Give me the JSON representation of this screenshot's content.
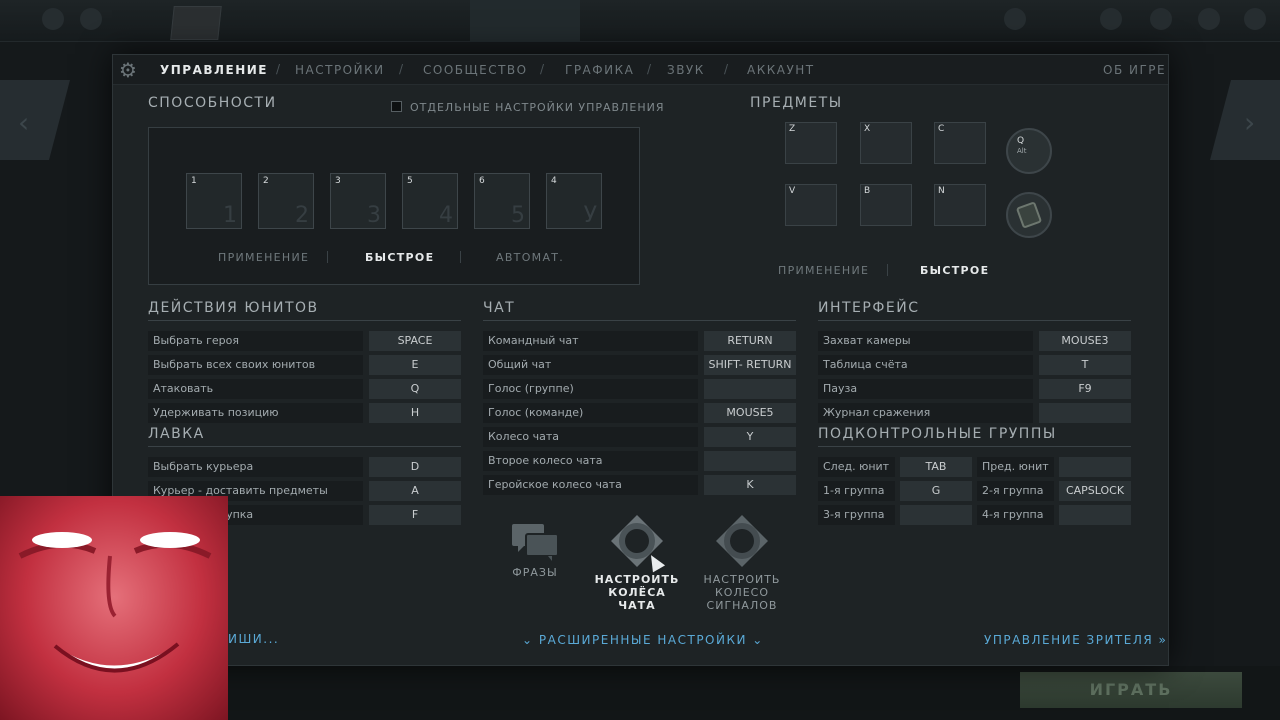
{
  "tabs": [
    {
      "label": "УПРАВЛЕНИЕ",
      "active": true
    },
    {
      "label": "НАСТРОЙКИ",
      "active": false
    },
    {
      "label": "СООБЩЕСТВО",
      "active": false
    },
    {
      "label": "ГРАФИКА",
      "active": false
    },
    {
      "label": "ЗВУК",
      "active": false
    },
    {
      "label": "АККАУНТ",
      "active": false
    }
  ],
  "tab_separator": "/",
  "about_label": "ОБ ИГРЕ",
  "abilities": {
    "title": "СПОСОБНОСТИ",
    "separate_controls_label": "ОТДЕЛЬНЫЕ НАСТРОЙКИ УПРАВЛЕНИЯ",
    "slots": [
      {
        "key": "1",
        "hint": "1"
      },
      {
        "key": "2",
        "hint": "2"
      },
      {
        "key": "3",
        "hint": "3"
      },
      {
        "key": "5",
        "hint": "4"
      },
      {
        "key": "6",
        "hint": "5"
      },
      {
        "key": "4",
        "hint": "У"
      }
    ],
    "modes": [
      {
        "label": "ПРИМЕНЕНИЕ",
        "active": false
      },
      {
        "label": "БЫСТРОЕ",
        "active": true
      },
      {
        "label": "АВТОМАТ.",
        "active": false
      }
    ]
  },
  "items": {
    "title": "ПРЕДМЕТЫ",
    "slots": [
      {
        "key": "Z"
      },
      {
        "key": "X"
      },
      {
        "key": "C"
      },
      {
        "key": "V"
      },
      {
        "key": "B"
      },
      {
        "key": "N"
      }
    ],
    "neutral_slot": {
      "key": "Q",
      "modifier": "Alt"
    },
    "modes": [
      {
        "label": "ПРИМЕНЕНИЕ",
        "active": false
      },
      {
        "label": "БЫСТРОЕ",
        "active": true
      }
    ]
  },
  "unit_actions": {
    "title": "ДЕЙСТВИЯ ЮНИТОВ",
    "rows": [
      {
        "label": "Выбрать героя",
        "key": "SPACE"
      },
      {
        "label": "Выбрать всех своих юнитов",
        "key": "E"
      },
      {
        "label": "Атаковать",
        "key": "Q"
      },
      {
        "label": "Удерживать позицию",
        "key": "H"
      }
    ]
  },
  "shop": {
    "title": "ЛАВКА",
    "rows": [
      {
        "label": "Выбрать курьера",
        "key": "D"
      },
      {
        "label": "Курьер - доставить предметы",
        "key": "A"
      },
      {
        "label": "Быстрая покупка",
        "key": "F"
      }
    ]
  },
  "chat": {
    "title": "ЧАТ",
    "rows": [
      {
        "label": "Командный чат",
        "key": "RETURN"
      },
      {
        "label": "Общий чат",
        "key": "SHIFT- RETURN"
      },
      {
        "label": "Голос (группе)",
        "key": ""
      },
      {
        "label": "Голос (команде)",
        "key": "MOUSE5"
      },
      {
        "label": "Колесо чата",
        "key": "Y"
      },
      {
        "label": "Второе колесо чата",
        "key": ""
      },
      {
        "label": "Геройское колесо чата",
        "key": "K"
      }
    ]
  },
  "interface": {
    "title": "ИНТЕРФЕЙС",
    "rows": [
      {
        "label": "Захват камеры",
        "key": "MOUSE3"
      },
      {
        "label": "Таблица счёта",
        "key": "T"
      },
      {
        "label": "Пауза",
        "key": "F9"
      },
      {
        "label": "Журнал сражения",
        "key": ""
      }
    ]
  },
  "control_groups": {
    "title": "ПОДКОНТРОЛЬНЫЕ ГРУППЫ",
    "rows": [
      {
        "label": "След. юнит",
        "key": "TAB",
        "label2": "Пред. юнит",
        "key2": ""
      },
      {
        "label": "1-я группа",
        "key": "G",
        "label2": "2-я группа",
        "key2": "CAPSLOCK"
      },
      {
        "label": "3-я группа",
        "key": "",
        "label2": "4-я группа",
        "key2": ""
      }
    ]
  },
  "chat_buttons": {
    "phrases": "ФРАЗЫ",
    "configure_chat_wheels": "НАСТРОИТЬ\nКОЛЁСА ЧАТА",
    "configure_signal_wheel": "НАСТРОИТЬ\nКОЛЕСО\nСИГНАЛОВ"
  },
  "footer": {
    "mouse_link": "ИШИ...",
    "advanced_settings": "РАСШИРЕННЫЕ НАСТРОЙКИ",
    "spectator_controls": "УПРАВЛЕНИЕ ЗРИТЕЛЯ"
  },
  "background": {
    "play_button": "ИГРАТЬ"
  }
}
